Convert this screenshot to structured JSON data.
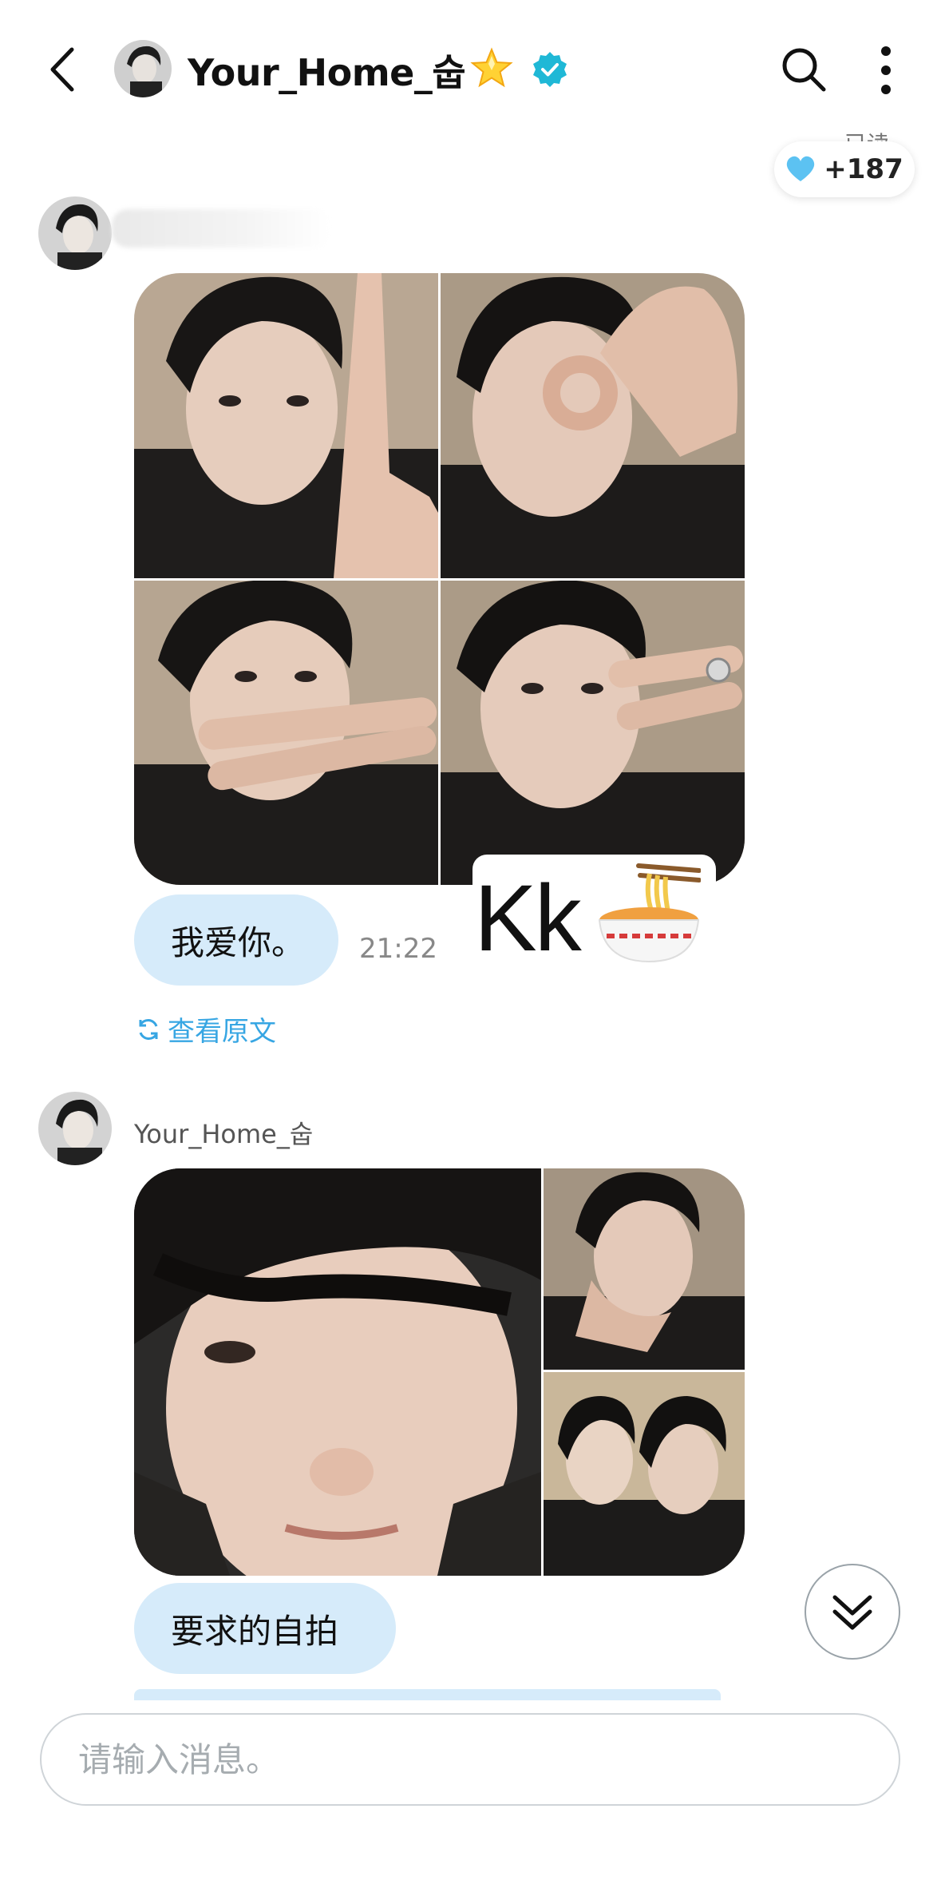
{
  "header": {
    "title": "Your_Home_숩",
    "star_emoji": "🌟",
    "verified": true
  },
  "partial_top_text": "已读",
  "likes": {
    "icon": "blue-heart-icon",
    "count": "+187"
  },
  "messages": [
    {
      "sender_blurred": true,
      "photo_count": 4,
      "bubble_text": "我爱你。",
      "time": "21:22",
      "sticker_text": "Kk",
      "sticker_emoji": "🍜",
      "translate_link": "查看原文"
    },
    {
      "sender": "Your_Home_숩",
      "photo_count": 3,
      "bubble_text": "要求的自拍"
    }
  ],
  "input": {
    "placeholder": "请输入消息。"
  },
  "colors": {
    "bubble": "#d6ebfa",
    "accent": "#37a6e3",
    "verified": "#1fb8d6"
  }
}
